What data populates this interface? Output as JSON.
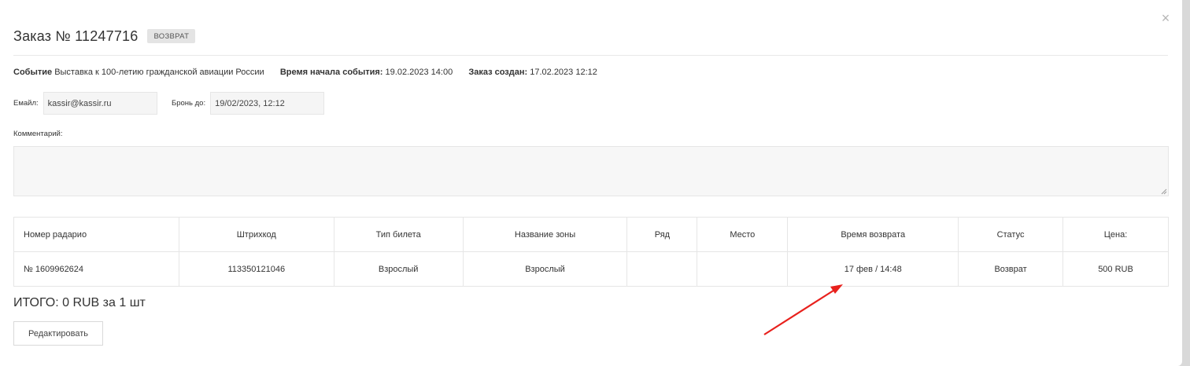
{
  "modal": {
    "title": "Заказ № 11247716",
    "status_badge": "ВОЗВРАТ",
    "close_glyph": "×"
  },
  "info": {
    "event_label": "Событие",
    "event_value": "Выставка к 100-летию гражданской авиации России",
    "start_label": "Время начала события:",
    "start_value": "19.02.2023 14:00",
    "created_label": "Заказ создан:",
    "created_value": "17.02.2023 12:12"
  },
  "fields": {
    "email_label": "Емайл:",
    "email_value": "kassir@kassir.ru",
    "reserve_label": "Бронь до:",
    "reserve_value": "19/02/2023, 12:12",
    "comment_label": "Комментарий:",
    "comment_value": ""
  },
  "table": {
    "headers": [
      "Номер радарио",
      "Штрихкод",
      "Тип билета",
      "Название зоны",
      "Ряд",
      "Место",
      "Время возврата",
      "Статус",
      "Цена:"
    ],
    "rows": [
      [
        "№ 1609962624",
        "113350121046",
        "Взрослый",
        "Взрослый",
        "",
        "",
        "17 фев / 14:48",
        "Возврат",
        "500 RUB"
      ]
    ]
  },
  "total": "ИТОГО: 0 RUB за 1 шт",
  "edit_button": "Редактировать",
  "colors": {
    "annotation_arrow": "#e8211d",
    "badge_bg": "#e4e4e4"
  }
}
